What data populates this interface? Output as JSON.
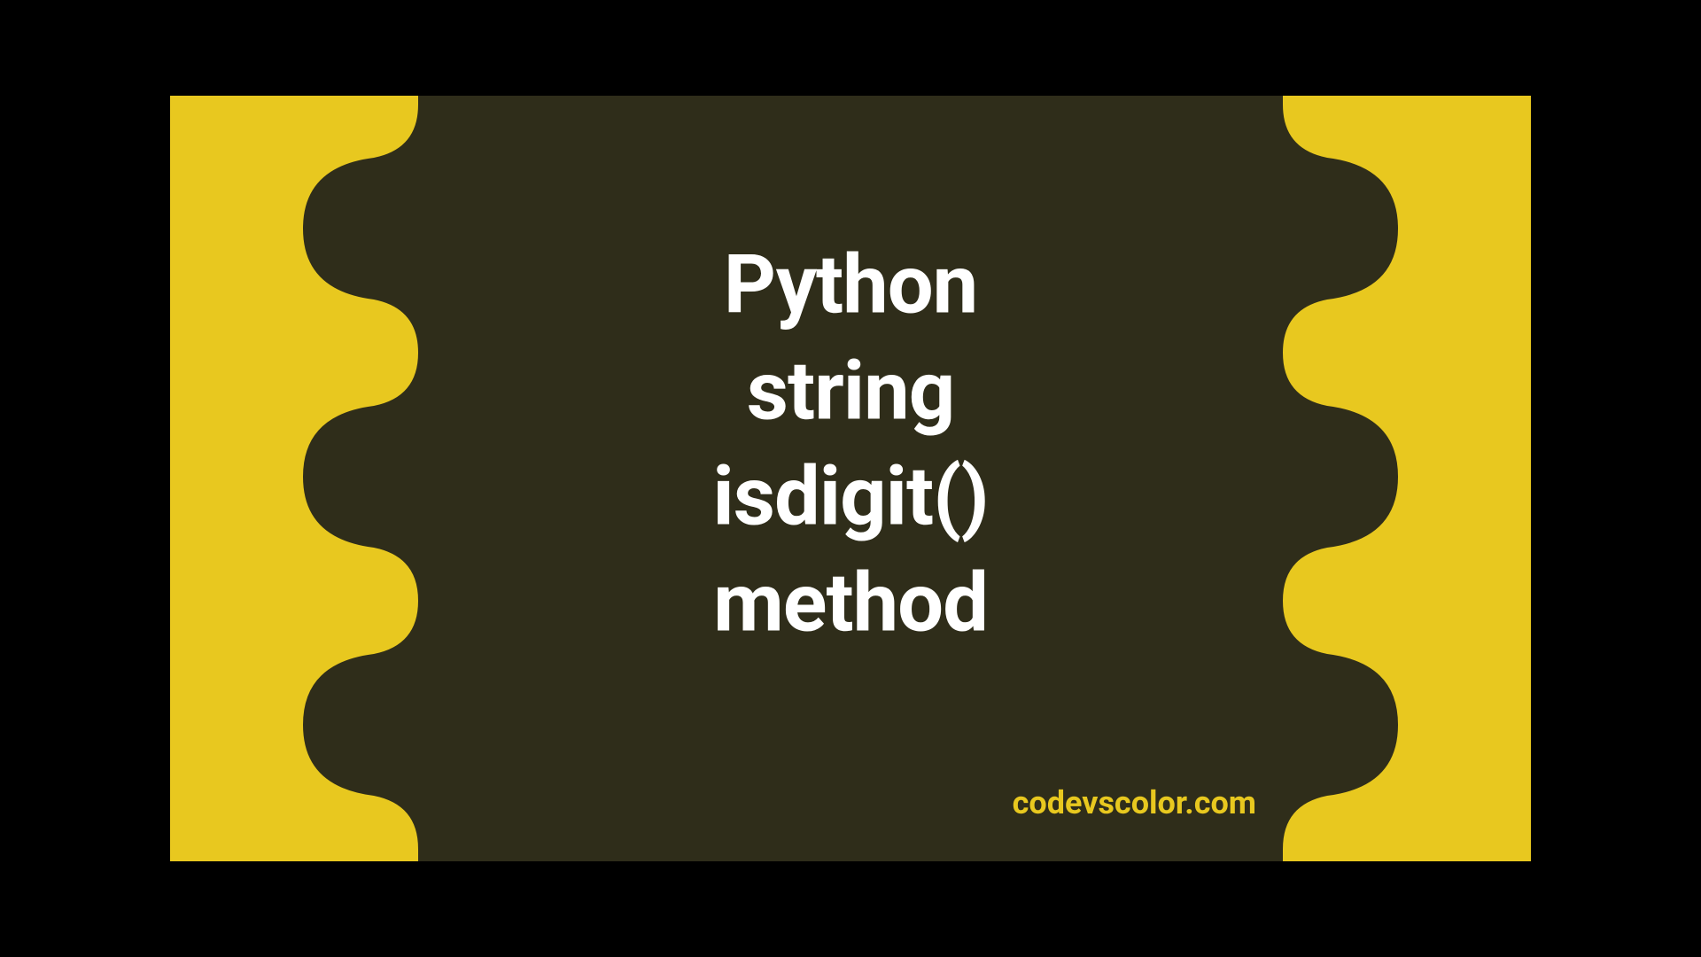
{
  "title": {
    "line1": "Python",
    "line2": "string",
    "line3": "isdigit()",
    "line4": "method"
  },
  "watermark": "codevscolor.com",
  "colors": {
    "background": "#e8c81f",
    "blob": "#2f2d1a",
    "text": "#ffffff"
  }
}
